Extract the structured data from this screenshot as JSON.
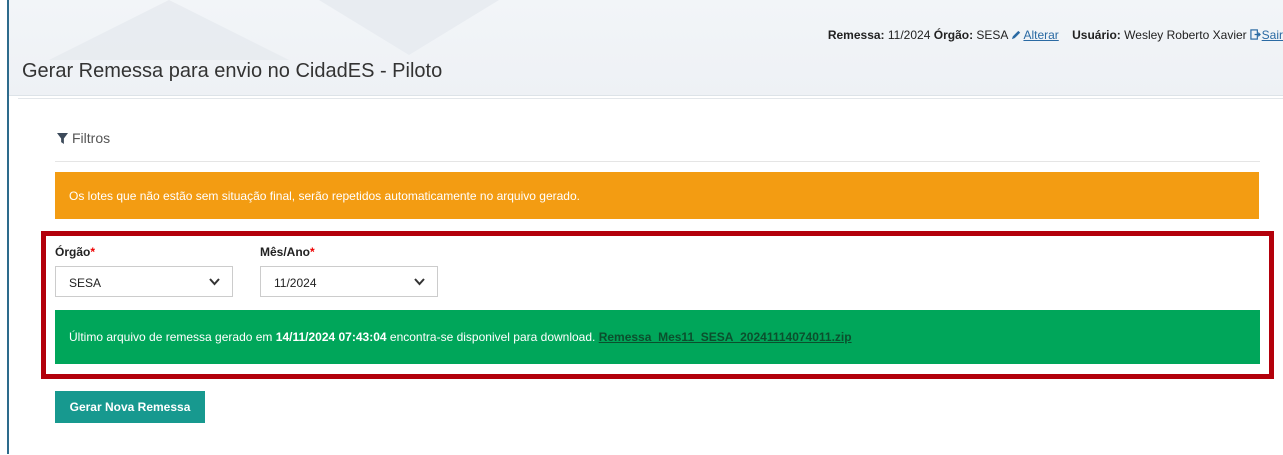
{
  "header": {
    "remessa_label": "Remessa:",
    "remessa_value": "11/2024",
    "orgao_label": "Órgão:",
    "orgao_value": "SESA",
    "alterar_link": "Alterar",
    "usuario_label": "Usuário:",
    "usuario_value": "Wesley Roberto Xavier",
    "sair_link": "Sair"
  },
  "page": {
    "title": "Gerar Remessa para envio no CidadES - Piloto"
  },
  "filters": {
    "title": "Filtros"
  },
  "warning": {
    "text": "Os lotes que não estão sem situação final, serão repetidos automaticamente no arquivo gerado."
  },
  "form": {
    "orgao": {
      "label": "Órgão",
      "required_mark": "*",
      "selected": "SESA"
    },
    "mes_ano": {
      "label": "Mês/Ano",
      "required_mark": "*",
      "selected": "11/2024"
    }
  },
  "success": {
    "prefix": "Último arquivo de remessa gerado em",
    "datetime": "14/11/2024 07:43:04",
    "suffix": "encontra-se disponivel para download.",
    "file_link": "Remessa_Mes11_SESA_20241114074011.zip"
  },
  "actions": {
    "generate_label": "Gerar Nova Remessa"
  },
  "colors": {
    "warning_bg": "#f39c12",
    "success_bg": "#00a65a",
    "button_bg": "#17998f",
    "highlight_border": "#b3000b"
  }
}
